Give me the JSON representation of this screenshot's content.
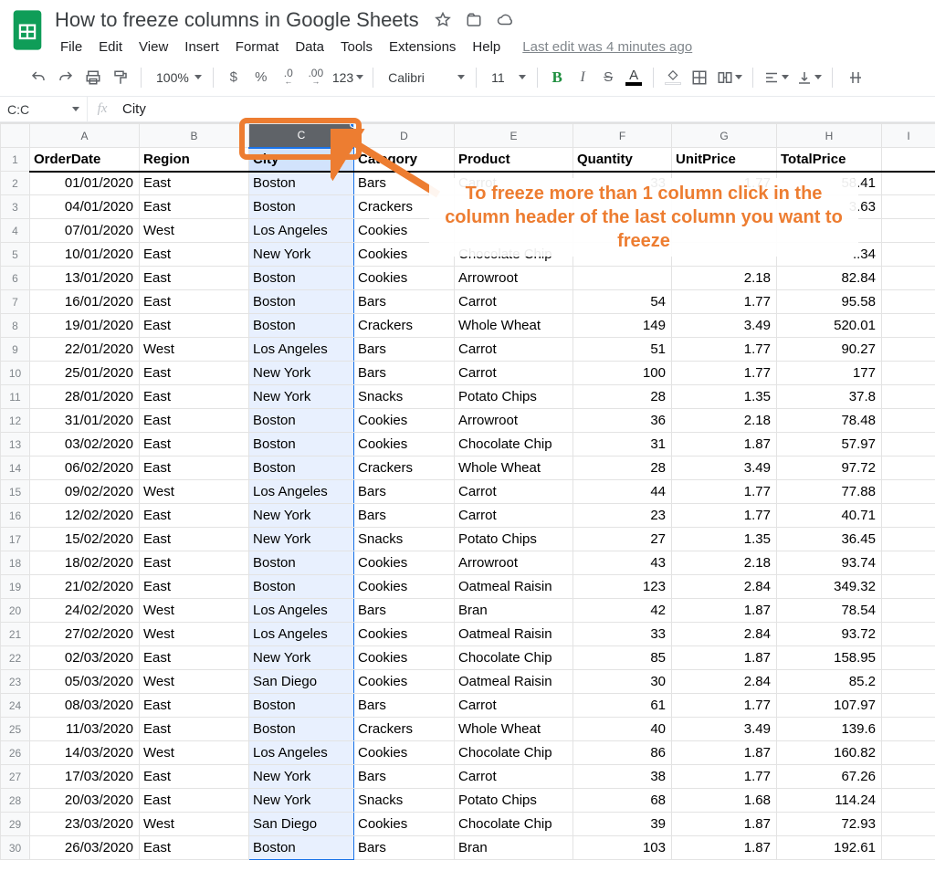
{
  "doc": {
    "title": "How to freeze columns in Google Sheets",
    "last_edit": "Last edit was 4 minutes ago"
  },
  "menubar": [
    "File",
    "Edit",
    "View",
    "Insert",
    "Format",
    "Data",
    "Tools",
    "Extensions",
    "Help"
  ],
  "toolbar": {
    "zoom": "100%",
    "currency": "$",
    "percent": "%",
    "dec_dec": ".0",
    "dec_inc": ".00",
    "more_fmt": "123",
    "font": "Calibri",
    "fontsize": "11",
    "bold": "B",
    "italic": "I",
    "strike": "S",
    "textcolor": "A"
  },
  "namebox": "C:C",
  "formula": "City",
  "columns": [
    "A",
    "B",
    "C",
    "D",
    "E",
    "F",
    "G",
    "H",
    "I"
  ],
  "headers": [
    "OrderDate",
    "Region",
    "City",
    "Category",
    "Product",
    "Quantity",
    "UnitPrice",
    "TotalPrice"
  ],
  "rows": [
    [
      "01/01/2020",
      "East",
      "Boston",
      "Bars",
      "Carrot",
      "33",
      "1.77",
      "58.41"
    ],
    [
      "04/01/2020",
      "East",
      "Boston",
      "Crackers",
      "",
      "",
      "",
      "3.63"
    ],
    [
      "07/01/2020",
      "West",
      "Los Angeles",
      "Cookies",
      "",
      "",
      "",
      ""
    ],
    [
      "10/01/2020",
      "East",
      "New York",
      "Cookies",
      "Chocolate Chip",
      "",
      "",
      "..34"
    ],
    [
      "13/01/2020",
      "East",
      "Boston",
      "Cookies",
      "Arrowroot",
      "",
      "2.18",
      "82.84"
    ],
    [
      "16/01/2020",
      "East",
      "Boston",
      "Bars",
      "Carrot",
      "54",
      "1.77",
      "95.58"
    ],
    [
      "19/01/2020",
      "East",
      "Boston",
      "Crackers",
      "Whole Wheat",
      "149",
      "3.49",
      "520.01"
    ],
    [
      "22/01/2020",
      "West",
      "Los Angeles",
      "Bars",
      "Carrot",
      "51",
      "1.77",
      "90.27"
    ],
    [
      "25/01/2020",
      "East",
      "New York",
      "Bars",
      "Carrot",
      "100",
      "1.77",
      "177"
    ],
    [
      "28/01/2020",
      "East",
      "New York",
      "Snacks",
      "Potato Chips",
      "28",
      "1.35",
      "37.8"
    ],
    [
      "31/01/2020",
      "East",
      "Boston",
      "Cookies",
      "Arrowroot",
      "36",
      "2.18",
      "78.48"
    ],
    [
      "03/02/2020",
      "East",
      "Boston",
      "Cookies",
      "Chocolate Chip",
      "31",
      "1.87",
      "57.97"
    ],
    [
      "06/02/2020",
      "East",
      "Boston",
      "Crackers",
      "Whole Wheat",
      "28",
      "3.49",
      "97.72"
    ],
    [
      "09/02/2020",
      "West",
      "Los Angeles",
      "Bars",
      "Carrot",
      "44",
      "1.77",
      "77.88"
    ],
    [
      "12/02/2020",
      "East",
      "New York",
      "Bars",
      "Carrot",
      "23",
      "1.77",
      "40.71"
    ],
    [
      "15/02/2020",
      "East",
      "New York",
      "Snacks",
      "Potato Chips",
      "27",
      "1.35",
      "36.45"
    ],
    [
      "18/02/2020",
      "East",
      "Boston",
      "Cookies",
      "Arrowroot",
      "43",
      "2.18",
      "93.74"
    ],
    [
      "21/02/2020",
      "East",
      "Boston",
      "Cookies",
      "Oatmeal Raisin",
      "123",
      "2.84",
      "349.32"
    ],
    [
      "24/02/2020",
      "West",
      "Los Angeles",
      "Bars",
      "Bran",
      "42",
      "1.87",
      "78.54"
    ],
    [
      "27/02/2020",
      "West",
      "Los Angeles",
      "Cookies",
      "Oatmeal Raisin",
      "33",
      "2.84",
      "93.72"
    ],
    [
      "02/03/2020",
      "East",
      "New York",
      "Cookies",
      "Chocolate Chip",
      "85",
      "1.87",
      "158.95"
    ],
    [
      "05/03/2020",
      "West",
      "San Diego",
      "Cookies",
      "Oatmeal Raisin",
      "30",
      "2.84",
      "85.2"
    ],
    [
      "08/03/2020",
      "East",
      "Boston",
      "Bars",
      "Carrot",
      "61",
      "1.77",
      "107.97"
    ],
    [
      "11/03/2020",
      "East",
      "Boston",
      "Crackers",
      "Whole Wheat",
      "40",
      "3.49",
      "139.6"
    ],
    [
      "14/03/2020",
      "West",
      "Los Angeles",
      "Cookies",
      "Chocolate Chip",
      "86",
      "1.87",
      "160.82"
    ],
    [
      "17/03/2020",
      "East",
      "New York",
      "Bars",
      "Carrot",
      "38",
      "1.77",
      "67.26"
    ],
    [
      "20/03/2020",
      "East",
      "New York",
      "Snacks",
      "Potato Chips",
      "68",
      "1.68",
      "114.24"
    ],
    [
      "23/03/2020",
      "West",
      "San Diego",
      "Cookies",
      "Chocolate Chip",
      "39",
      "1.87",
      "72.93"
    ],
    [
      "26/03/2020",
      "East",
      "Boston",
      "Bars",
      "Bran",
      "103",
      "1.87",
      "192.61"
    ]
  ],
  "annotation": {
    "text": "To freeze more than 1 column click in the column header of the last column you want to freeze"
  },
  "selected_column_index": 2,
  "colors": {
    "accent": "#ed7d31",
    "select_blue": "#1a73e8"
  }
}
